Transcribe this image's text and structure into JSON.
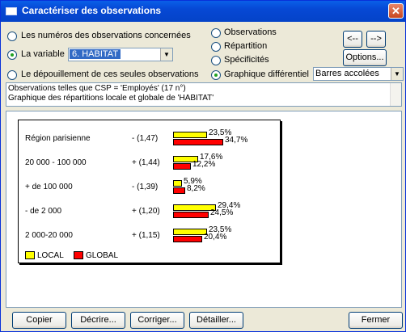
{
  "window": {
    "title": "Caractériser des observations",
    "close_glyph": "✕"
  },
  "options": {
    "radio_observations_concernees": "Les numéros des observations concernées",
    "radio_variable": "La variable",
    "variable_value": "6. HABITAT",
    "radio_depouillement": "Le dépouillement de ces seules observations",
    "radio_observations": "Observations",
    "radio_repartition": "Répartition",
    "radio_specificites": "Spécificités",
    "radio_graphique": "Graphique différentiel",
    "graph_type_value": "Barres accolées",
    "prev_button": "<--",
    "next_button": "-->",
    "options_button": "Options..."
  },
  "description": {
    "line1": "Observations telles que CSP = 'Employés' (17 n°)",
    "line2": "Graphique des répartitions locale et globale de 'HABITAT'"
  },
  "chart_data": {
    "type": "bar",
    "orientation": "horizontal",
    "categories": [
      "Région parisienne",
      "20 000 - 100 000",
      "+ de 100 000",
      "- de 2 000",
      "2 000-20 000"
    ],
    "scores": [
      "- (1,47)",
      "+ (1,44)",
      "- (1,39)",
      "+ (1,20)",
      "+ (1,15)"
    ],
    "series": [
      {
        "name": "LOCAL",
        "color": "#ffff00",
        "values": [
          23.5,
          17.6,
          5.9,
          29.4,
          23.5
        ],
        "labels": [
          "23,5%",
          "17,6%",
          "5,9%",
          "29,4%",
          "23,5%"
        ]
      },
      {
        "name": "GLOBAL",
        "color": "#ff0000",
        "values": [
          34.7,
          12.2,
          8.2,
          24.5,
          20.4
        ],
        "labels": [
          "34,7%",
          "12,2%",
          "8,2%",
          "24,5%",
          "20,4%"
        ]
      }
    ],
    "legend_position": "bottom-left"
  },
  "footer": {
    "copier": "Copier",
    "decrire": "Décrire...",
    "corriger": "Corriger...",
    "detailler": "Détailler...",
    "fermer": "Fermer"
  }
}
